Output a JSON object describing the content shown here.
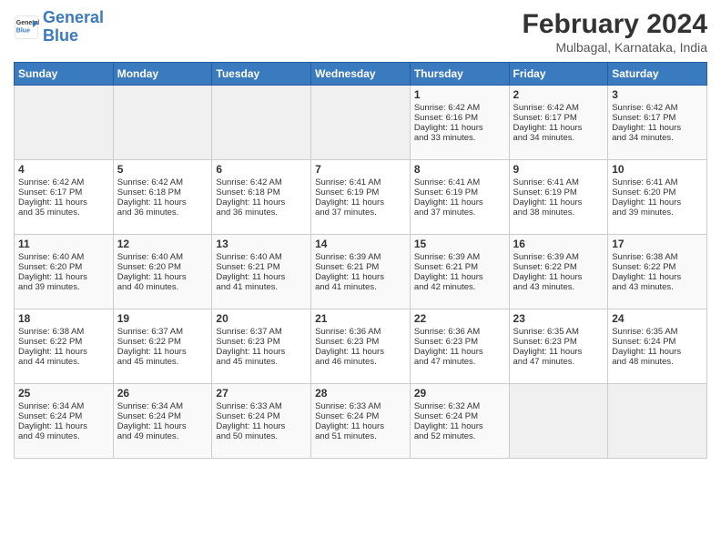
{
  "header": {
    "logo_general": "General",
    "logo_blue": "Blue",
    "month_title": "February 2024",
    "location": "Mulbagal, Karnataka, India"
  },
  "days_of_week": [
    "Sunday",
    "Monday",
    "Tuesday",
    "Wednesday",
    "Thursday",
    "Friday",
    "Saturday"
  ],
  "weeks": [
    [
      {
        "day": "",
        "info": ""
      },
      {
        "day": "",
        "info": ""
      },
      {
        "day": "",
        "info": ""
      },
      {
        "day": "",
        "info": ""
      },
      {
        "day": "1",
        "info": "Sunrise: 6:42 AM\nSunset: 6:16 PM\nDaylight: 11 hours\nand 33 minutes."
      },
      {
        "day": "2",
        "info": "Sunrise: 6:42 AM\nSunset: 6:17 PM\nDaylight: 11 hours\nand 34 minutes."
      },
      {
        "day": "3",
        "info": "Sunrise: 6:42 AM\nSunset: 6:17 PM\nDaylight: 11 hours\nand 34 minutes."
      }
    ],
    [
      {
        "day": "4",
        "info": "Sunrise: 6:42 AM\nSunset: 6:17 PM\nDaylight: 11 hours\nand 35 minutes."
      },
      {
        "day": "5",
        "info": "Sunrise: 6:42 AM\nSunset: 6:18 PM\nDaylight: 11 hours\nand 36 minutes."
      },
      {
        "day": "6",
        "info": "Sunrise: 6:42 AM\nSunset: 6:18 PM\nDaylight: 11 hours\nand 36 minutes."
      },
      {
        "day": "7",
        "info": "Sunrise: 6:41 AM\nSunset: 6:19 PM\nDaylight: 11 hours\nand 37 minutes."
      },
      {
        "day": "8",
        "info": "Sunrise: 6:41 AM\nSunset: 6:19 PM\nDaylight: 11 hours\nand 37 minutes."
      },
      {
        "day": "9",
        "info": "Sunrise: 6:41 AM\nSunset: 6:19 PM\nDaylight: 11 hours\nand 38 minutes."
      },
      {
        "day": "10",
        "info": "Sunrise: 6:41 AM\nSunset: 6:20 PM\nDaylight: 11 hours\nand 39 minutes."
      }
    ],
    [
      {
        "day": "11",
        "info": "Sunrise: 6:40 AM\nSunset: 6:20 PM\nDaylight: 11 hours\nand 39 minutes."
      },
      {
        "day": "12",
        "info": "Sunrise: 6:40 AM\nSunset: 6:20 PM\nDaylight: 11 hours\nand 40 minutes."
      },
      {
        "day": "13",
        "info": "Sunrise: 6:40 AM\nSunset: 6:21 PM\nDaylight: 11 hours\nand 41 minutes."
      },
      {
        "day": "14",
        "info": "Sunrise: 6:39 AM\nSunset: 6:21 PM\nDaylight: 11 hours\nand 41 minutes."
      },
      {
        "day": "15",
        "info": "Sunrise: 6:39 AM\nSunset: 6:21 PM\nDaylight: 11 hours\nand 42 minutes."
      },
      {
        "day": "16",
        "info": "Sunrise: 6:39 AM\nSunset: 6:22 PM\nDaylight: 11 hours\nand 43 minutes."
      },
      {
        "day": "17",
        "info": "Sunrise: 6:38 AM\nSunset: 6:22 PM\nDaylight: 11 hours\nand 43 minutes."
      }
    ],
    [
      {
        "day": "18",
        "info": "Sunrise: 6:38 AM\nSunset: 6:22 PM\nDaylight: 11 hours\nand 44 minutes."
      },
      {
        "day": "19",
        "info": "Sunrise: 6:37 AM\nSunset: 6:22 PM\nDaylight: 11 hours\nand 45 minutes."
      },
      {
        "day": "20",
        "info": "Sunrise: 6:37 AM\nSunset: 6:23 PM\nDaylight: 11 hours\nand 45 minutes."
      },
      {
        "day": "21",
        "info": "Sunrise: 6:36 AM\nSunset: 6:23 PM\nDaylight: 11 hours\nand 46 minutes."
      },
      {
        "day": "22",
        "info": "Sunrise: 6:36 AM\nSunset: 6:23 PM\nDaylight: 11 hours\nand 47 minutes."
      },
      {
        "day": "23",
        "info": "Sunrise: 6:35 AM\nSunset: 6:23 PM\nDaylight: 11 hours\nand 47 minutes."
      },
      {
        "day": "24",
        "info": "Sunrise: 6:35 AM\nSunset: 6:24 PM\nDaylight: 11 hours\nand 48 minutes."
      }
    ],
    [
      {
        "day": "25",
        "info": "Sunrise: 6:34 AM\nSunset: 6:24 PM\nDaylight: 11 hours\nand 49 minutes."
      },
      {
        "day": "26",
        "info": "Sunrise: 6:34 AM\nSunset: 6:24 PM\nDaylight: 11 hours\nand 49 minutes."
      },
      {
        "day": "27",
        "info": "Sunrise: 6:33 AM\nSunset: 6:24 PM\nDaylight: 11 hours\nand 50 minutes."
      },
      {
        "day": "28",
        "info": "Sunrise: 6:33 AM\nSunset: 6:24 PM\nDaylight: 11 hours\nand 51 minutes."
      },
      {
        "day": "29",
        "info": "Sunrise: 6:32 AM\nSunset: 6:24 PM\nDaylight: 11 hours\nand 52 minutes."
      },
      {
        "day": "",
        "info": ""
      },
      {
        "day": "",
        "info": ""
      }
    ]
  ]
}
